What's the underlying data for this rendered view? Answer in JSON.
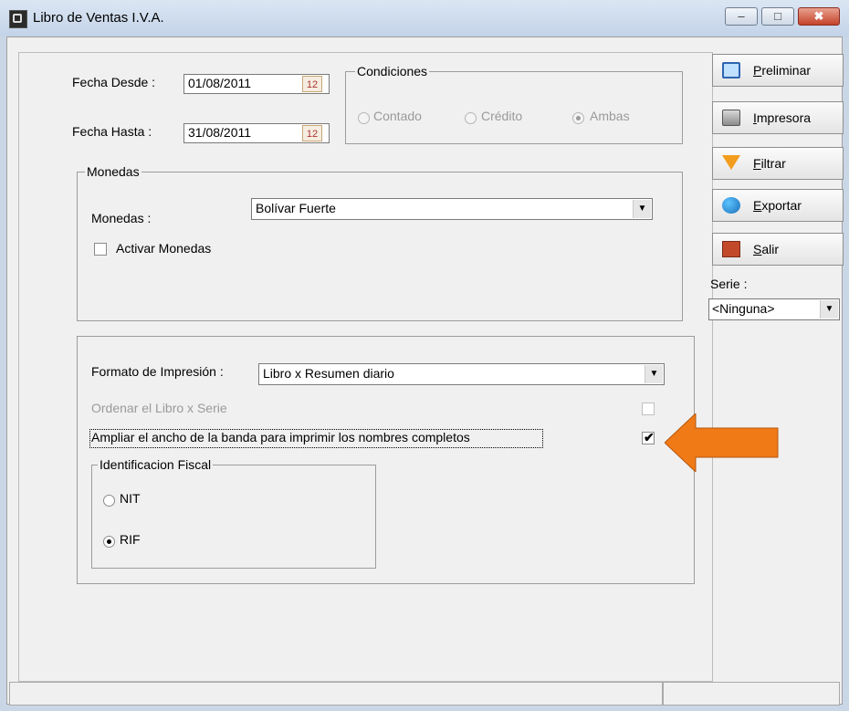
{
  "window": {
    "title": "Libro de Ventas I.V.A.",
    "controls": {
      "minimize": "–",
      "maximize": "□",
      "close": "✖"
    }
  },
  "dates": {
    "desde_label": "Fecha Desde :",
    "desde_value": "01/08/2011",
    "hasta_label": "Fecha Hasta :",
    "hasta_value": "31/08/2011",
    "calendar_glyph": "12"
  },
  "condiciones": {
    "title": "Condiciones",
    "options": [
      {
        "label": "Contado",
        "selected": false
      },
      {
        "label": "Crédito",
        "selected": false
      },
      {
        "label": "Ambas",
        "selected": true
      }
    ]
  },
  "monedas": {
    "group_title": "Monedas",
    "label": "Monedas :",
    "value": "Bolívar Fuerte",
    "activar_label": "Activar Monedas",
    "activar_checked": false
  },
  "impresion": {
    "formato_label": "Formato de Impresión :",
    "formato_value": "Libro x Resumen diario",
    "ordenar_label": "Ordenar el Libro x Serie",
    "ordenar_checked": false,
    "ampliar_label": "Ampliar el ancho de la banda para imprimir los nombres completos",
    "ampliar_checked": true,
    "check_glyph": "✔"
  },
  "identificacion": {
    "title": "Identificacion Fiscal",
    "options": [
      {
        "label": "NIT",
        "selected": false
      },
      {
        "label": "RIF",
        "selected": true
      }
    ]
  },
  "actions": [
    {
      "key": "P",
      "rest": "reliminar",
      "icon": "monitor-icon"
    },
    {
      "key": "I",
      "rest": "mpresora",
      "icon": "printer-icon"
    },
    {
      "key": "F",
      "rest": "iltrar",
      "icon": "filter-icon"
    },
    {
      "key": "E",
      "rest": "xportar",
      "icon": "globe-icon"
    },
    {
      "key": "S",
      "rest": "alir",
      "icon": "exit-door-icon"
    }
  ],
  "serie": {
    "label": "Serie :",
    "value": "<Ninguna>"
  },
  "dropdown_glyph": "▼",
  "colors": {
    "arrow": "#f07a16"
  }
}
